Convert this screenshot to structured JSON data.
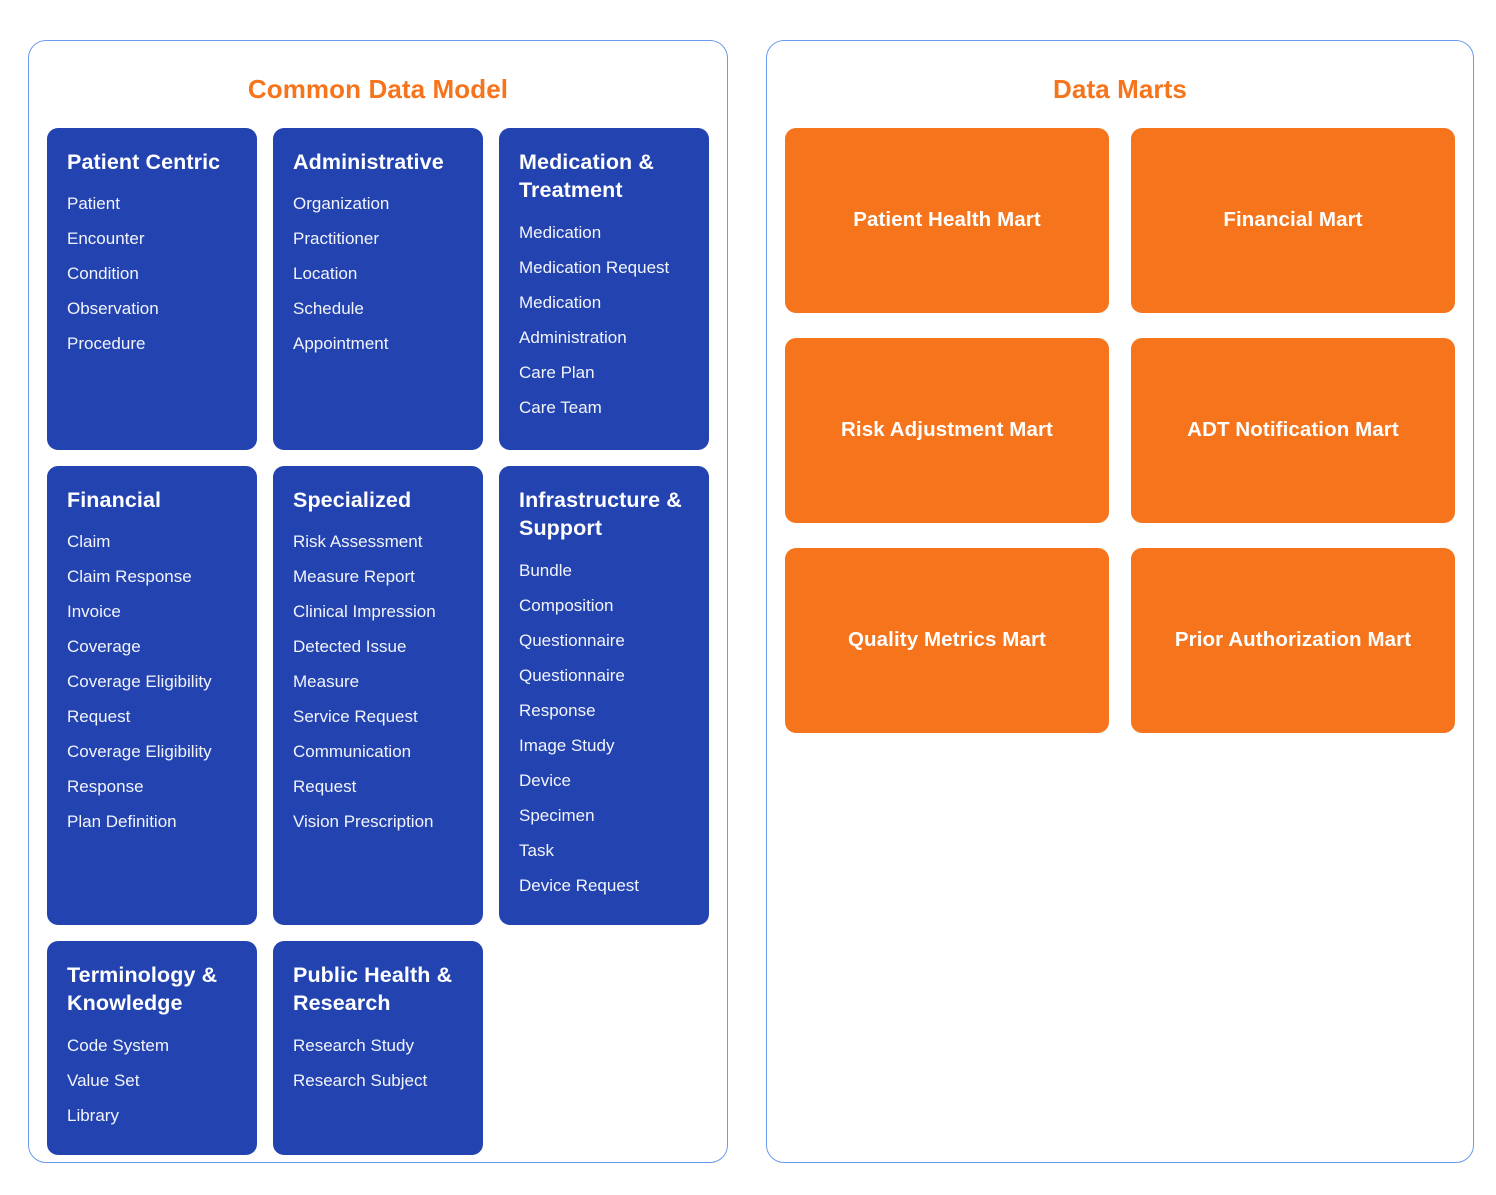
{
  "colors": {
    "panel_border": "#6a9bee",
    "accent_orange": "#f5741c",
    "card_blue": "#2343b0",
    "card_text": "#ffffff",
    "background": "#ffffff"
  },
  "cdm_panel": {
    "title": "Common Data Model",
    "cards": [
      {
        "title": "Patient Centric",
        "items": [
          "Patient",
          "Encounter",
          "Condition",
          "Observation",
          "Procedure"
        ]
      },
      {
        "title": "Administrative",
        "items": [
          "Organization",
          "Practitioner",
          "Location",
          "Schedule",
          "Appointment"
        ]
      },
      {
        "title": "Medication & Treatment",
        "items": [
          "Medication",
          "Medication Request",
          "Medication Administration",
          "Care Plan",
          "Care Team"
        ]
      },
      {
        "title": "Financial",
        "items": [
          "Claim",
          "Claim Response",
          "Invoice",
          "Coverage",
          "Coverage Eligibility Request",
          "Coverage Eligibility Response",
          "Plan Definition"
        ]
      },
      {
        "title": "Specialized",
        "items": [
          "Risk Assessment",
          "Measure Report",
          "Clinical Impression",
          "Detected Issue",
          "Measure",
          "Service Request",
          "Communication Request",
          "Vision Prescription"
        ]
      },
      {
        "title": "Infrastructure & Support",
        "items": [
          "Bundle",
          "Composition",
          "Questionnaire",
          "Questionnaire Response",
          "Image Study",
          "Device",
          "Specimen",
          "Task",
          "Device Request"
        ]
      },
      {
        "title": "Terminology & Knowledge",
        "items": [
          "Code System",
          "Value Set",
          "Library"
        ]
      },
      {
        "title": "Public Health & Research",
        "items": [
          "Research Study",
          "Research Subject"
        ]
      }
    ]
  },
  "marts_panel": {
    "title": "Data Marts",
    "marts": [
      {
        "label": "Patient Health Mart"
      },
      {
        "label": "Financial Mart"
      },
      {
        "label": "Risk Adjustment Mart"
      },
      {
        "label": "ADT Notification Mart"
      },
      {
        "label": "Quality Metrics Mart"
      },
      {
        "label": "Prior Authorization Mart"
      }
    ]
  }
}
